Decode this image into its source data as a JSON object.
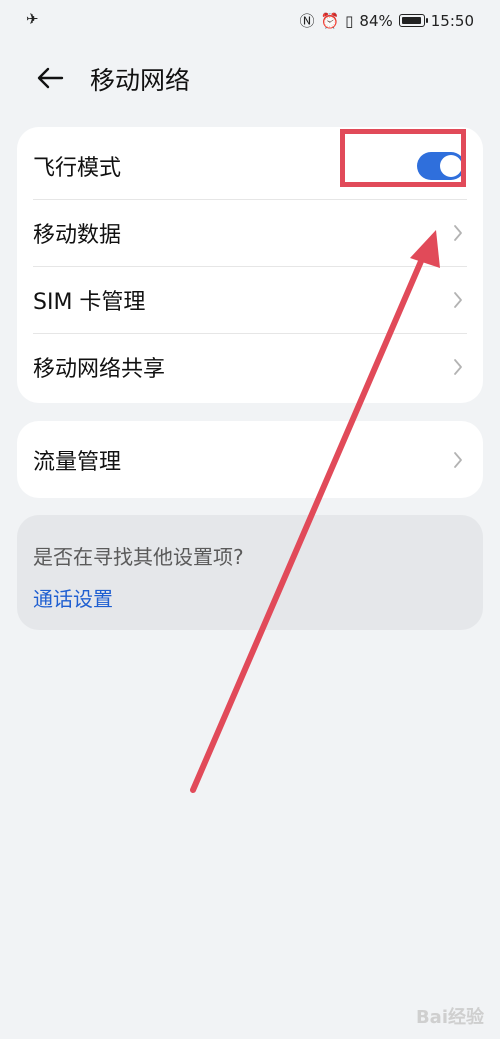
{
  "status": {
    "percent": "84%",
    "time": "15:50"
  },
  "header": {
    "title": "移动网络"
  },
  "settings": [
    {
      "label": "飞行模式",
      "toggle_on": true
    },
    {
      "label": "移动数据"
    },
    {
      "label": "SIM 卡管理"
    },
    {
      "label": "移动网络共享"
    }
  ],
  "data_usage": {
    "label": "流量管理"
  },
  "suggestion": {
    "question": "是否在寻找其他设置项?",
    "link": "通话设置"
  },
  "colors": {
    "accent": "#2f6fdc",
    "link": "#1f5fd1",
    "annotation": "#e14a59"
  },
  "watermark": "Bai经验"
}
